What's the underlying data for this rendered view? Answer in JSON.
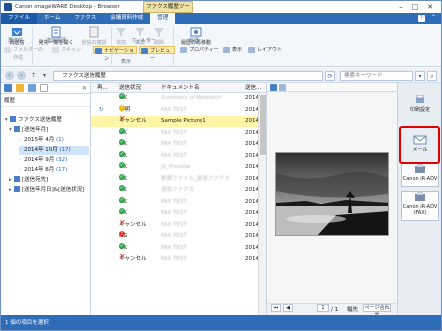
{
  "window": {
    "title": "Canon imageWARE Desktop - Browser",
    "context_tab": "ファクス履歴ツール"
  },
  "ribbon_tabs": [
    "ファイル",
    "ホーム",
    "ファクス",
    "会議資料作成",
    "管理"
  ],
  "ribbon": {
    "resend": "再送信",
    "fax_list": "発先一覧を開く",
    "check": "受信の確認",
    "add": "追加",
    "edit": "編集",
    "delete": "削除",
    "history_move": "履歴の再移動",
    "folder_create": "フォルダーの作成",
    "scan": "スキャン",
    "navigation": "ナビゲーション",
    "preview": "プレビュー",
    "property": "プロパティー",
    "display": "表示",
    "layout": "レイアウト",
    "groups": [
      "再送信",
      "送信履歴",
      "フィルター",
      "",
      "履歴",
      "表示"
    ]
  },
  "addressbar": {
    "path": "ファクス送信履歴",
    "search_placeholder": "検索キーワード"
  },
  "left_pane": {
    "header": "履歴",
    "tree": [
      {
        "label": "ファクス送信履歴",
        "count": "",
        "level": 0
      },
      {
        "label": "[送信年月]",
        "count": "",
        "level": 1
      },
      {
        "label": "2015年 4月",
        "count": "(1)",
        "level": 2
      },
      {
        "label": "2014年 10月",
        "count": "(17)",
        "level": 2
      },
      {
        "label": "2014年 9月",
        "count": "(32)",
        "level": 2
      },
      {
        "label": "2014年 8月",
        "count": "(17)",
        "level": 2
      },
      {
        "label": "[送信宛先]",
        "count": "",
        "level": 1
      },
      {
        "label": "[送信年月日]&[送信状況]",
        "count": "",
        "level": 1
      }
    ]
  },
  "list": {
    "columns": [
      "再...",
      "送信状況",
      "ドキュメント名",
      "送信..."
    ],
    "rows": [
      {
        "status": "OK",
        "type": "ok",
        "doc": "Summary of Research",
        "date": "2014",
        "blur": true
      },
      {
        "status": "不明",
        "type": "unk",
        "doc": "FAX TEST",
        "date": "2014",
        "blur": true
      },
      {
        "status": "キャンセル",
        "type": "bad",
        "doc": "Sample Picture1",
        "date": "2014",
        "blur": false
      },
      {
        "status": "OK",
        "type": "ok",
        "doc": "FAX TEST",
        "date": "2014",
        "blur": true
      },
      {
        "status": "OK",
        "type": "ok",
        "doc": "FAX TEST",
        "date": "2014",
        "blur": true
      },
      {
        "status": "OK",
        "type": "ok",
        "doc": "FAX TEST",
        "date": "2014",
        "blur": true
      },
      {
        "status": "OK",
        "type": "ok",
        "doc": "JS_Preview",
        "date": "2014",
        "blur": true
      },
      {
        "status": "OK",
        "type": "ok",
        "doc": "新規ファイル_送信ファクス",
        "date": "2014",
        "blur": true
      },
      {
        "status": "OK",
        "type": "ok",
        "doc": "送信ファクス",
        "date": "2014",
        "blur": true
      },
      {
        "status": "OK",
        "type": "ok",
        "doc": "FAX TEST",
        "date": "2014",
        "blur": true
      },
      {
        "status": "OK",
        "type": "ok",
        "doc": "FAX TEST",
        "date": "2014",
        "blur": true
      },
      {
        "status": "キャンセル",
        "type": "bad",
        "doc": "FAX TEST",
        "date": "2014",
        "blur": true
      },
      {
        "status": "NG",
        "type": "ng",
        "doc": "FAX TEST",
        "date": "2014",
        "blur": true
      },
      {
        "status": "OK",
        "type": "ok",
        "doc": "FAX TEST",
        "date": "2014",
        "blur": true
      },
      {
        "status": "キャンセル",
        "type": "bad",
        "doc": "FAX TEST",
        "date": "2014",
        "blur": true
      }
    ]
  },
  "preview_bar": {
    "page": "1",
    "total": "/ 1",
    "fit": "幅先",
    "zoom": "ページ合わせ"
  },
  "right_panel": {
    "print_settings": "印刷設定",
    "mail": "メール",
    "dest1": "Canon iR-ADV",
    "dest2": "Canon iR-ADV (FAX)"
  },
  "status_bar": "1 個の項目を選択",
  "colors": {
    "accent": "#2f6db8",
    "highlight_row": "#fff5a6",
    "callout": "#e10000"
  }
}
